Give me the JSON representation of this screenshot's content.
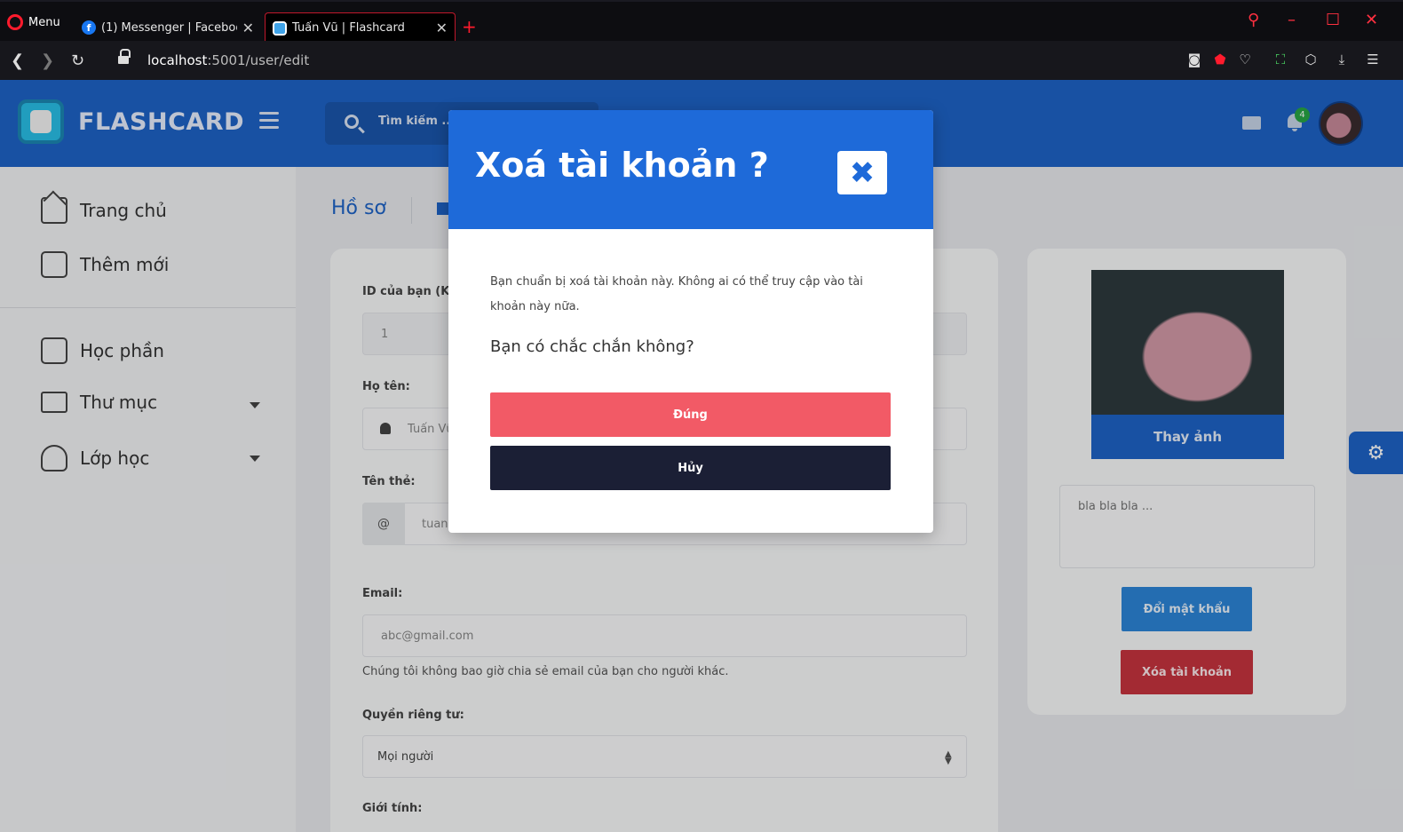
{
  "browser": {
    "menu_label": "Menu",
    "tabs": [
      {
        "title": "(1) Messenger | Facebook",
        "fav": "f"
      },
      {
        "title": "Tuấn Vũ | Flashcard"
      }
    ],
    "new_tab": "+",
    "close_glyph": "✕",
    "url_host": "localhost",
    "url_path": ":5001/user/edit"
  },
  "header": {
    "brand": "FLASHCARD",
    "search_placeholder": "Tìm kiếm ...",
    "notification_count": "4"
  },
  "sidebar": {
    "items": [
      {
        "label": "Trang chủ",
        "icon": "home-icon"
      },
      {
        "label": "Thêm mới",
        "icon": "edit-icon"
      },
      {
        "label": "Học phần",
        "icon": "copy-icon"
      },
      {
        "label": "Thư mục",
        "icon": "folder-icon"
      },
      {
        "label": "Lớp học",
        "icon": "user-icon"
      }
    ]
  },
  "page": {
    "breadcrumb_title": "Hồ sơ",
    "form": {
      "id_label": "ID của bạn (Khô",
      "id_value": "1",
      "name_label": "Họ tên:",
      "name_value": "Tuấn Vũ",
      "username_label": "Tên thẻ:",
      "username_prefix": "@",
      "username_value": "tuan",
      "email_label": "Email:",
      "email_placeholder": "abc@gmail.com",
      "email_help": "Chúng tôi không bao giờ chia sẻ email của bạn cho người khác.",
      "privacy_label": "Quyền riêng tư:",
      "privacy_value": "Mọi người",
      "gender_label": "Giới tính:"
    },
    "side": {
      "change_photo": "Thay ảnh",
      "bio_placeholder": "bla bla bla ...",
      "change_password": "Đổi mật khẩu",
      "delete_account": "Xóa tài khoản"
    }
  },
  "modal": {
    "title": "Xoá tài khoản ?",
    "message": "Bạn chuẩn bị xoá tài khoản này. Không ai có thể truy cập vào tài khoản này nữa.",
    "question": "Bạn có chắc chắn không?",
    "confirm_label": "Đúng",
    "cancel_label": "Hủy",
    "close_glyph": "✖"
  },
  "colors": {
    "primary": "#1e63c7",
    "danger": "#f25a66",
    "dark": "#1b1f35"
  }
}
